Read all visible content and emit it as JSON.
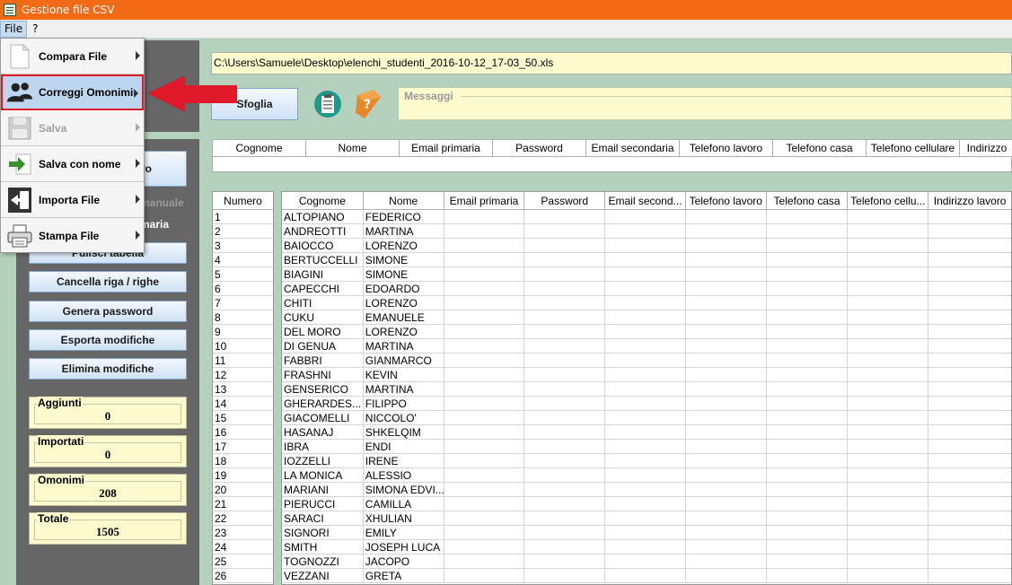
{
  "window": {
    "title": "Gestione file CSV"
  },
  "menubar": {
    "file": "File",
    "help": "?"
  },
  "file_menu": {
    "items": [
      {
        "label": "Compara File",
        "icon": "document-icon"
      },
      {
        "label": "Correggi Omonimi",
        "icon": "users-icon"
      },
      {
        "label": "Salva",
        "icon": "floppy-icon"
      },
      {
        "label": "Salva con nome",
        "icon": "save-as-icon"
      },
      {
        "label": "Importa File",
        "icon": "import-icon"
      },
      {
        "label": "Stampa File",
        "icon": "printer-icon"
      }
    ]
  },
  "path_field": {
    "value": "C:\\Users\\Samuele\\Desktop\\elenchi_studenti_2016-10-12_17-03_50.xls"
  },
  "buttons": {
    "sfoglia": "Sfoglia",
    "nuovo_partial": "ro",
    "manuale_partial": "manuale",
    "primaria_partial": "maria",
    "pulisci": "Pulisci tabella",
    "cancella": "Cancella riga / righe",
    "genera": "Genera password",
    "esporta": "Esporta modifiche",
    "elimina": "Elimina modifiche"
  },
  "messages": {
    "label": "Messaggi"
  },
  "stats": [
    {
      "label": "Aggiunti",
      "value": "0"
    },
    {
      "label": "Importati",
      "value": "0"
    },
    {
      "label": "Omonimi",
      "value": "208"
    },
    {
      "label": "Totale",
      "value": "1505"
    }
  ],
  "top_header": [
    "Cognome",
    "Nome",
    "Email primaria",
    "Password",
    "Email secondaria",
    "Telefono lavoro",
    "Telefono casa",
    "Telefono cellulare",
    "Indirizzo"
  ],
  "num_header": "Numero",
  "grid_header": [
    "Cognome",
    "Nome",
    "Email primaria",
    "Password",
    "Email second...",
    "Telefono lavoro",
    "Telefono casa",
    "Telefono cellu...",
    "Indirizzo lavoro"
  ],
  "rows": [
    {
      "n": "1",
      "cognome": "ALTOPIANO",
      "nome": "FEDERICO"
    },
    {
      "n": "2",
      "cognome": "ANDREOTTI",
      "nome": "MARTINA"
    },
    {
      "n": "3",
      "cognome": "BAIOCCO",
      "nome": "LORENZO"
    },
    {
      "n": "4",
      "cognome": "BERTUCCELLI",
      "nome": "SIMONE"
    },
    {
      "n": "5",
      "cognome": "BIAGINI",
      "nome": "SIMONE"
    },
    {
      "n": "6",
      "cognome": "CAPECCHI",
      "nome": "EDOARDO"
    },
    {
      "n": "7",
      "cognome": "CHITI",
      "nome": "LORENZO"
    },
    {
      "n": "8",
      "cognome": "CUKU",
      "nome": "EMANUELE"
    },
    {
      "n": "9",
      "cognome": "DEL MORO",
      "nome": "LORENZO"
    },
    {
      "n": "10",
      "cognome": "DI GENUA",
      "nome": "MARTINA"
    },
    {
      "n": "11",
      "cognome": "FABBRI",
      "nome": "GIANMARCO"
    },
    {
      "n": "12",
      "cognome": "FRASHNI",
      "nome": "KEVIN"
    },
    {
      "n": "13",
      "cognome": "GENSERICO",
      "nome": "MARTINA"
    },
    {
      "n": "14",
      "cognome": "GHERARDES...",
      "nome": "FILIPPO"
    },
    {
      "n": "15",
      "cognome": "GIACOMELLI",
      "nome": "NICCOLO'"
    },
    {
      "n": "16",
      "cognome": "HASANAJ",
      "nome": "SHKELQIM"
    },
    {
      "n": "17",
      "cognome": "IBRA",
      "nome": "ENDI"
    },
    {
      "n": "18",
      "cognome": "IOZZELLI",
      "nome": "IRENE"
    },
    {
      "n": "19",
      "cognome": "LA MONICA",
      "nome": "ALESSIO"
    },
    {
      "n": "20",
      "cognome": "MARIANI",
      "nome": "SIMONA EDVI..."
    },
    {
      "n": "21",
      "cognome": "PIERUCCI",
      "nome": "CAMILLA"
    },
    {
      "n": "22",
      "cognome": "SARACI",
      "nome": "XHULIAN"
    },
    {
      "n": "23",
      "cognome": "SIGNORI",
      "nome": "EMILY"
    },
    {
      "n": "24",
      "cognome": "SMITH",
      "nome": "JOSEPH LUCA"
    },
    {
      "n": "25",
      "cognome": "TOGNOZZI",
      "nome": "JACOPO"
    },
    {
      "n": "26",
      "cognome": "VEZZANI",
      "nome": "GRETA"
    }
  ],
  "colors": {
    "titlebar": "#f26a16",
    "background": "#b3d1bd",
    "panel": "#666666",
    "field": "#fdfbcd",
    "highlight": "#e0192a"
  }
}
